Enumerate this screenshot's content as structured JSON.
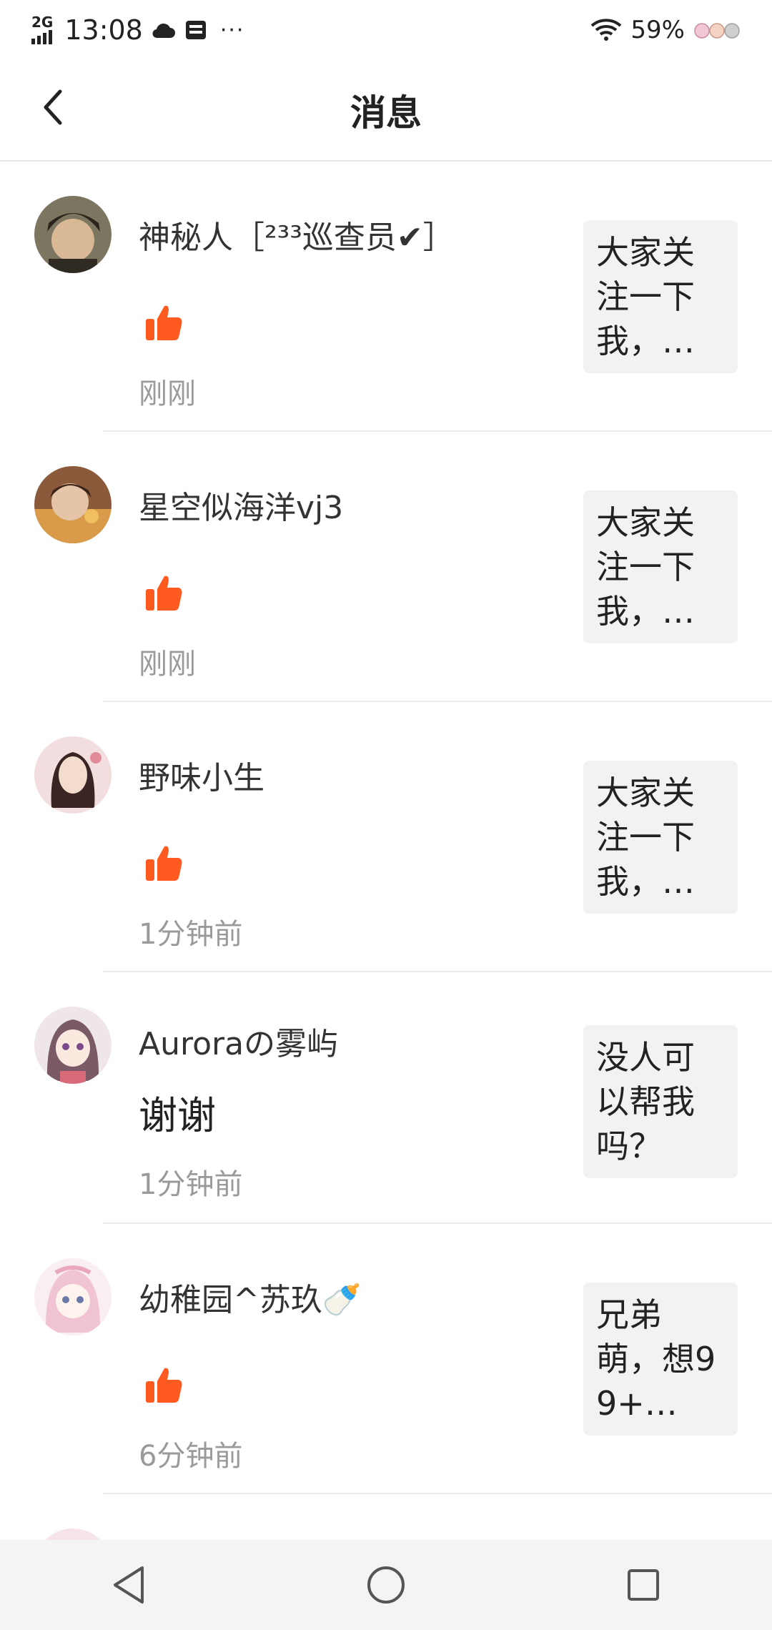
{
  "status_bar": {
    "network": "2G",
    "time": "13:08",
    "dots": "···",
    "battery": "59%"
  },
  "header": {
    "title": "消息"
  },
  "messages": [
    {
      "name": "神秘人［²³³巡查员✔］",
      "type": "like",
      "time": "刚刚",
      "quote": "大家关注一下我，…",
      "avatar_colors": [
        "#3a3326",
        "#c9a98a"
      ]
    },
    {
      "name": "星空似海洋vj3",
      "type": "like",
      "time": "刚刚",
      "quote": "大家关注一下我，…",
      "avatar_colors": [
        "#5a3b2a",
        "#d99a4a"
      ]
    },
    {
      "name": "野味小生",
      "type": "like",
      "time": "1分钟前",
      "quote": "大家关注一下我，…",
      "avatar_colors": [
        "#f0d8d8",
        "#6b3b3b"
      ]
    },
    {
      "name": "Auroraの雾屿",
      "type": "reply",
      "reply": "谢谢",
      "time": "1分钟前",
      "quote": "没人可以帮我吗？",
      "avatar_colors": [
        "#f3e6ea",
        "#7a5a6a"
      ]
    },
    {
      "name": "幼稚园^苏玖🍼",
      "type": "like",
      "time": "6分钟前",
      "quote": "兄弟萌，想99+…",
      "avatar_colors": [
        "#f7e3ea",
        "#e9a8c0"
      ]
    }
  ],
  "colors": {
    "like_orange": "#ff5a1f",
    "time_gray": "#9a9a9a",
    "quote_bg": "#f2f2f2"
  }
}
